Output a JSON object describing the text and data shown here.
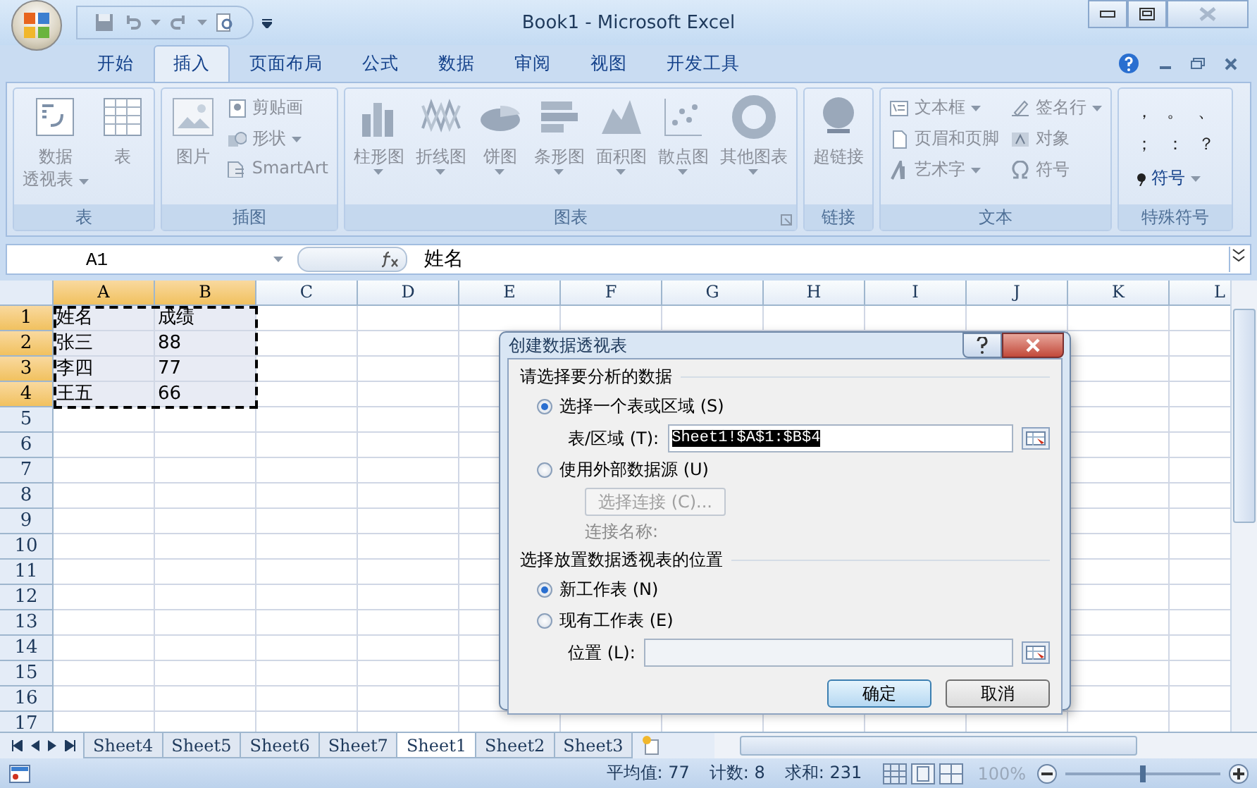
{
  "window": {
    "title": "Book1 - Microsoft Excel"
  },
  "ribbon_tabs": [
    {
      "label": "开始",
      "selected": false
    },
    {
      "label": "插入",
      "selected": true
    },
    {
      "label": "页面布局",
      "selected": false
    },
    {
      "label": "公式",
      "selected": false
    },
    {
      "label": "数据",
      "selected": false
    },
    {
      "label": "审阅",
      "selected": false
    },
    {
      "label": "视图",
      "selected": false
    },
    {
      "label": "开发工具",
      "selected": false
    }
  ],
  "ribbon_groups": [
    {
      "label": "表",
      "items": [
        {
          "kind": "large",
          "lines": [
            "数据",
            "透视表"
          ],
          "dropdown": true
        },
        {
          "kind": "large",
          "lines": [
            "表"
          ],
          "dropdown": false
        }
      ]
    },
    {
      "label": "插图",
      "items": [
        {
          "kind": "large",
          "lines": [
            "图片"
          ],
          "dropdown": false
        },
        {
          "kind": "stack",
          "items": [
            {
              "label": "剪贴画",
              "dropdown": false
            },
            {
              "label": "形状",
              "dropdown": true
            },
            {
              "label": "SmartArt",
              "dropdown": false
            }
          ]
        }
      ]
    },
    {
      "label": "图表",
      "launcher": true,
      "items": [
        {
          "kind": "large",
          "lines": [
            "柱形图"
          ],
          "dropdown": true
        },
        {
          "kind": "large",
          "lines": [
            "折线图"
          ],
          "dropdown": true
        },
        {
          "kind": "large",
          "lines": [
            "饼图"
          ],
          "dropdown": true
        },
        {
          "kind": "large",
          "lines": [
            "条形图"
          ],
          "dropdown": true
        },
        {
          "kind": "large",
          "lines": [
            "面积图"
          ],
          "dropdown": true
        },
        {
          "kind": "large",
          "lines": [
            "散点图"
          ],
          "dropdown": true
        },
        {
          "kind": "large",
          "lines": [
            "其他图表"
          ],
          "dropdown": true
        }
      ]
    },
    {
      "label": "链接",
      "items": [
        {
          "kind": "large",
          "lines": [
            "超链接"
          ],
          "dropdown": false
        }
      ]
    },
    {
      "label": "文本",
      "items": [
        {
          "kind": "stack",
          "items": [
            {
              "label": "文本框",
              "dropdown": true
            },
            {
              "label": "页眉和页脚",
              "dropdown": false
            },
            {
              "label": "艺术字",
              "dropdown": true
            }
          ]
        },
        {
          "kind": "stack",
          "items": [
            {
              "label": "签名行",
              "dropdown": true
            },
            {
              "label": "对象",
              "dropdown": false
            },
            {
              "label": "符号",
              "dropdown": false
            }
          ]
        }
      ]
    },
    {
      "label": "特殊符号",
      "items": [
        {
          "kind": "symbols",
          "symbols": [
            "，",
            "。",
            "、",
            "；",
            "：",
            "？"
          ],
          "button": {
            "label": "符号",
            "dropdown": true
          }
        }
      ]
    }
  ],
  "formula_bar": {
    "name_box": "A1",
    "formula": "姓名"
  },
  "sheet": {
    "columns": [
      {
        "label": "A",
        "selected": true
      },
      {
        "label": "B",
        "selected": true
      },
      {
        "label": "C",
        "selected": false
      },
      {
        "label": "D",
        "selected": false
      },
      {
        "label": "E",
        "selected": false
      },
      {
        "label": "F",
        "selected": false
      },
      {
        "label": "G",
        "selected": false
      },
      {
        "label": "H",
        "selected": false
      },
      {
        "label": "I",
        "selected": false
      },
      {
        "label": "J",
        "selected": false
      },
      {
        "label": "K",
        "selected": false
      },
      {
        "label": "L",
        "selected": false
      }
    ],
    "rows": [
      {
        "label": "1",
        "selected": true,
        "cells": [
          "姓名",
          "成绩"
        ]
      },
      {
        "label": "2",
        "selected": true,
        "cells": [
          "张三",
          "88"
        ]
      },
      {
        "label": "3",
        "selected": true,
        "cells": [
          "李四",
          "77"
        ]
      },
      {
        "label": "4",
        "selected": true,
        "cells": [
          "王五",
          "66"
        ]
      },
      {
        "label": "5",
        "selected": false,
        "cells": []
      },
      {
        "label": "6",
        "selected": false,
        "cells": []
      },
      {
        "label": "7",
        "selected": false,
        "cells": []
      },
      {
        "label": "8",
        "selected": false,
        "cells": []
      },
      {
        "label": "9",
        "selected": false,
        "cells": []
      },
      {
        "label": "10",
        "selected": false,
        "cells": []
      },
      {
        "label": "11",
        "selected": false,
        "cells": []
      },
      {
        "label": "12",
        "selected": false,
        "cells": []
      },
      {
        "label": "13",
        "selected": false,
        "cells": []
      },
      {
        "label": "14",
        "selected": false,
        "cells": []
      },
      {
        "label": "15",
        "selected": false,
        "cells": []
      },
      {
        "label": "16",
        "selected": false,
        "cells": []
      },
      {
        "label": "17",
        "selected": false,
        "cells": []
      }
    ]
  },
  "dialog": {
    "title": "创建数据透视表",
    "section_1": "请选择要分析的数据",
    "option_range": {
      "label": "选择一个表或区域 (S)",
      "selected": true
    },
    "range_label": "表/区域 (T):",
    "range_value": "Sheet1!$A$1:$B$4",
    "option_external": {
      "label": "使用外部数据源 (U)",
      "selected": false
    },
    "choose_connection": "选择连接 (C)...",
    "connection_name": "连接名称:",
    "section_2": "选择放置数据透视表的位置",
    "option_new": {
      "label": "新工作表 (N)",
      "selected": true
    },
    "option_existing": {
      "label": "现有工作表 (E)",
      "selected": false
    },
    "location_label": "位置 (L):",
    "ok": "确定",
    "cancel": "取消"
  },
  "sheet_tabs": [
    {
      "label": "Sheet4",
      "selected": false
    },
    {
      "label": "Sheet5",
      "selected": false
    },
    {
      "label": "Sheet6",
      "selected": false
    },
    {
      "label": "Sheet7",
      "selected": false
    },
    {
      "label": "Sheet1",
      "selected": true
    },
    {
      "label": "Sheet2",
      "selected": false
    },
    {
      "label": "Sheet3",
      "selected": false
    }
  ],
  "status_bar": {
    "stats": [
      "平均值: 77",
      "计数: 8",
      "求和: 231"
    ],
    "zoom": "100%",
    "level": 0.5
  }
}
